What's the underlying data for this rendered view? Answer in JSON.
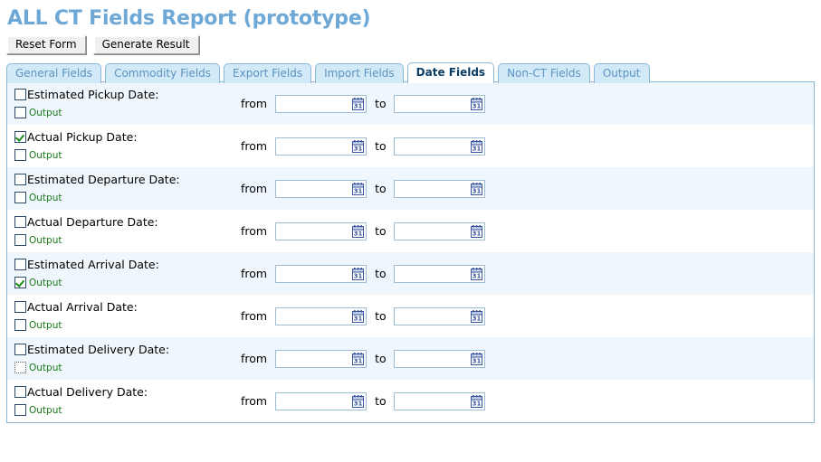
{
  "page": {
    "title": "ALL CT Fields Report (prototype)",
    "title_color": "#6ea8d6"
  },
  "toolbar": {
    "reset_label": "Reset Form",
    "generate_label": "Generate Result"
  },
  "tabs": [
    {
      "label": "General Fields",
      "active": false
    },
    {
      "label": "Commodity Fields",
      "active": false
    },
    {
      "label": "Export Fields",
      "active": false
    },
    {
      "label": "Import Fields",
      "active": false
    },
    {
      "label": "Date Fields",
      "active": true
    },
    {
      "label": "Non-CT Fields",
      "active": false
    },
    {
      "label": "Output",
      "active": false
    }
  ],
  "labels": {
    "from": "from",
    "to": "to",
    "output": "Output",
    "date_placeholder": ""
  },
  "icons": {
    "calendar": "calendar-31-icon"
  },
  "colors": {
    "accent": "#6ea8d6",
    "tab_inactive_bg": "#d2e9f8",
    "tab_border": "#8bb8d8",
    "row_alt_bg": "#eff7fd",
    "output_text": "#1a7a1a",
    "active_tab_text": "#0a3d66"
  },
  "rows": [
    {
      "label": "Estimated Pickup Date:",
      "field_checked": false,
      "output_checked": false,
      "output_focused": false,
      "from_value": "",
      "to_value": "",
      "alt": true
    },
    {
      "label": "Actual Pickup Date:",
      "field_checked": true,
      "output_checked": false,
      "output_focused": false,
      "from_value": "",
      "to_value": "",
      "alt": false
    },
    {
      "label": "Estimated Departure Date:",
      "field_checked": false,
      "output_checked": false,
      "output_focused": false,
      "from_value": "",
      "to_value": "",
      "alt": true
    },
    {
      "label": "Actual Departure Date:",
      "field_checked": false,
      "output_checked": false,
      "output_focused": false,
      "from_value": "",
      "to_value": "",
      "alt": false
    },
    {
      "label": "Estimated Arrival Date:",
      "field_checked": false,
      "output_checked": true,
      "output_focused": false,
      "from_value": "",
      "to_value": "",
      "alt": true
    },
    {
      "label": "Actual Arrival Date:",
      "field_checked": false,
      "output_checked": false,
      "output_focused": false,
      "from_value": "",
      "to_value": "",
      "alt": false
    },
    {
      "label": "Estimated Delivery Date:",
      "field_checked": false,
      "output_checked": false,
      "output_focused": true,
      "from_value": "",
      "to_value": "",
      "alt": true
    },
    {
      "label": "Actual Delivery Date:",
      "field_checked": false,
      "output_checked": false,
      "output_focused": false,
      "from_value": "",
      "to_value": "",
      "alt": false
    }
  ]
}
